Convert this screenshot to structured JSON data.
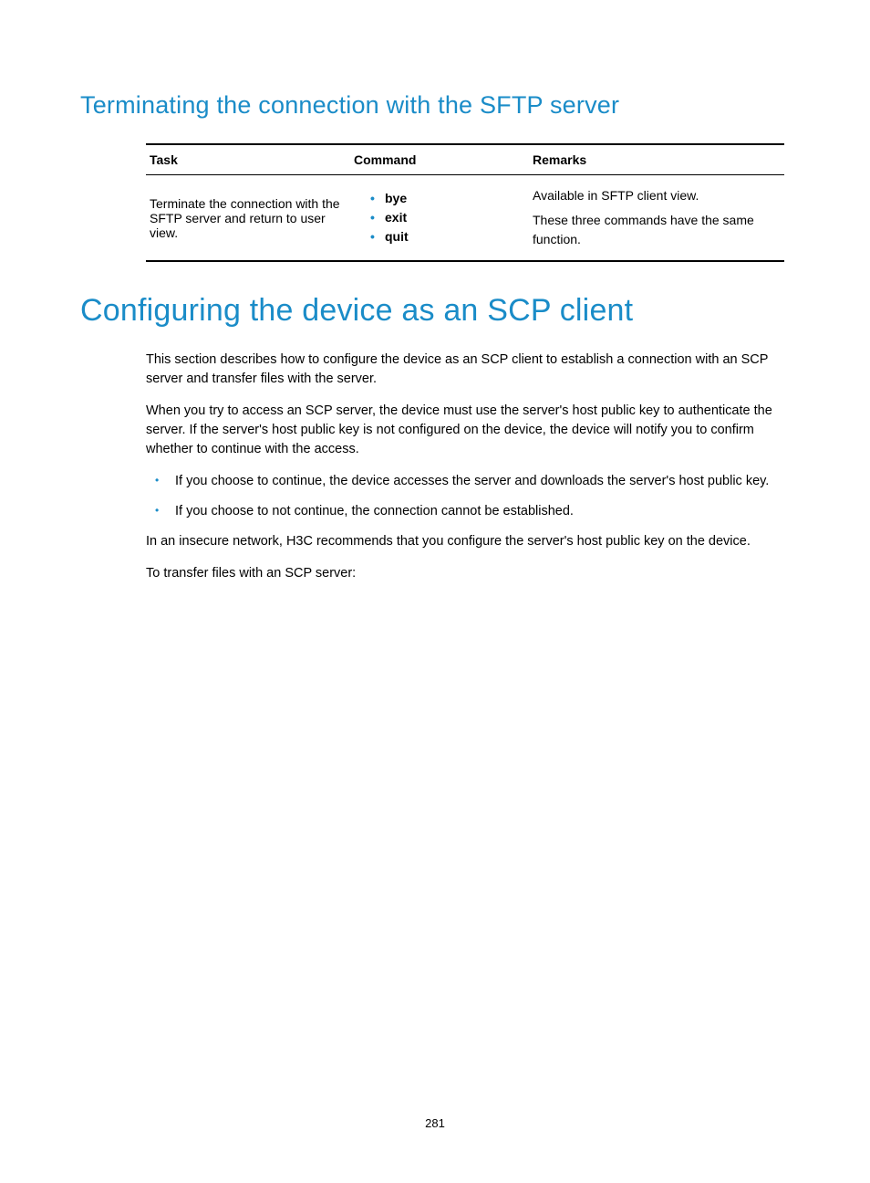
{
  "section1": {
    "heading": "Terminating the connection with the SFTP server",
    "table": {
      "headers": {
        "task": "Task",
        "command": "Command",
        "remarks": "Remarks"
      },
      "row": {
        "task": "Terminate the connection with the SFTP server and return to user view.",
        "commands": [
          "bye",
          "exit",
          "quit"
        ],
        "remarks": {
          "line1": "Available in SFTP client view.",
          "line2": "These three commands have the same function."
        }
      }
    }
  },
  "section2": {
    "heading": "Configuring the device as an SCP client",
    "paragraphs": {
      "p1": "This section describes how to configure the device as an SCP client to establish a connection with an SCP server and transfer files with the server.",
      "p2": "When you try to access an SCP server, the device must use the server's host public key to authenticate the server. If the server's host public key is not configured on the device, the device will notify you to confirm whether to continue with the access.",
      "p3": "In an insecure network, H3C recommends that you configure the server's host public key on the device.",
      "p4": "To transfer files with an SCP server:"
    },
    "bullets": {
      "b1": "If you choose to continue, the device accesses the server and downloads the server's host public key.",
      "b2": "If you choose to not continue, the connection cannot be established."
    }
  },
  "pageNumber": "281"
}
